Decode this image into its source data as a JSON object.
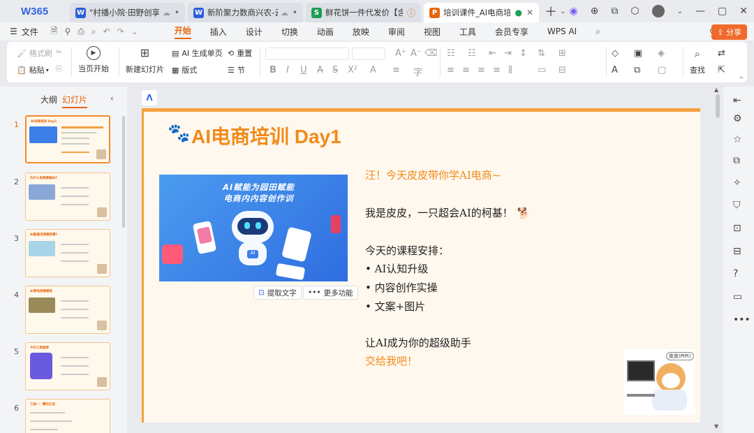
{
  "app": {
    "logo": "W365"
  },
  "tabs": [
    {
      "icon": "W",
      "title": "\"村播小院·田野创享",
      "color": "#2b5fd9"
    },
    {
      "icon": "W",
      "title": "新阶聚力数商兴农-云",
      "color": "#2b5fd9"
    },
    {
      "icon": "S",
      "title": "鲜花饼一件代发价【含运费",
      "color": "#1f9d55"
    },
    {
      "icon": "P",
      "title": "培训课件_AI电商培训",
      "color": "#e8650a"
    }
  ],
  "menu": {
    "file": "文件",
    "items": [
      "开始",
      "插入",
      "设计",
      "切换",
      "动画",
      "放映",
      "审阅",
      "视图",
      "工具",
      "会员专享",
      "WPS AI"
    ],
    "share": "分享"
  },
  "ribbon": {
    "format_painter": "格式刷",
    "paste": "粘贴",
    "from_current": "当页开始",
    "new_slide": "新建幻灯片",
    "ai_single": "AI 生成单页",
    "layout": "版式",
    "reset": "重置",
    "section": "节",
    "find": "查找"
  },
  "sidebar": {
    "tab_outline": "大纲",
    "tab_slides": "幻灯片",
    "thumbs": [
      {
        "num": "1",
        "title": "AI电商培训 Day1"
      },
      {
        "num": "2",
        "title": "为什么电商要做AI?"
      },
      {
        "num": "3",
        "title": "AI能做电商哪些事?"
      },
      {
        "num": "4",
        "title": "AI帮电商做哪些"
      },
      {
        "num": "5",
        "title": "今日工具推荐"
      },
      {
        "num": "6",
        "title": "工具一：腾讯元宝"
      }
    ]
  },
  "slide": {
    "title": "AI电商培训 Day1",
    "image_caption": "AI赋能为园田赋能电商内容创作",
    "image_caption_line1": "AI赋能为园田赋能",
    "image_caption_line2": "电商内内容创作训",
    "extract_text": "提取文字",
    "more": "更多功能",
    "greeting": "汪！今天皮皮带你学AI电商~",
    "intro": "我是皮皮，一只超会AI的柯基！",
    "schedule_title": "今天的课程安排：",
    "schedule": [
      "• AI认知升级",
      "• 内容创作实操",
      "• 文案+图片"
    ],
    "closing1": "让AI成为你的超级助手",
    "closing2": "交给我吧！",
    "dog_label": "皮皮(PiPi)"
  }
}
